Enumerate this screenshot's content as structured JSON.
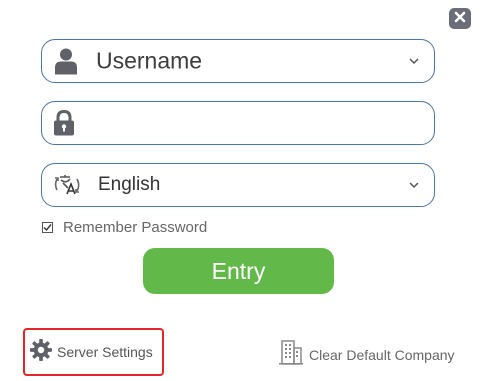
{
  "window": {
    "close_icon": "close-x-icon"
  },
  "login": {
    "username": {
      "value": "Username",
      "icon": "user-icon"
    },
    "password": {
      "value": "",
      "placeholder": "",
      "icon": "lock-icon"
    },
    "language": {
      "selected": "English",
      "icon": "translate-icon"
    },
    "remember_password": {
      "label": "Remember Password",
      "checked": true
    },
    "entry_label": "Entry"
  },
  "footer": {
    "server_settings_label": "Server Settings",
    "server_settings_icon": "gear-icon",
    "clear_company_label": "Clear Default Company",
    "clear_company_icon": "building-icon"
  },
  "colors": {
    "accent_green": "#62b94a",
    "field_border": "#4d74a3",
    "highlight_red": "#e1272b",
    "icon_gray": "#6b6e78"
  }
}
